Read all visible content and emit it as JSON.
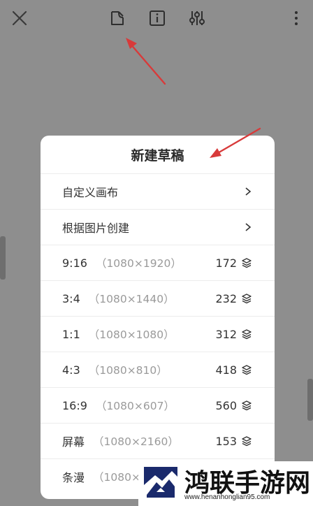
{
  "toolbar": {
    "icons": [
      "close-icon",
      "sticker-icon",
      "info-icon",
      "sliders-icon",
      "more-vertical-icon"
    ]
  },
  "dialog": {
    "title": "新建草稿",
    "options": [
      {
        "label": "自定义画布"
      },
      {
        "label": "根据图片创建"
      }
    ],
    "presets": [
      {
        "ratio": "9:16",
        "resolution": "（1080×1920）",
        "layers": "172"
      },
      {
        "ratio": "3:4",
        "resolution": "（1080×1440）",
        "layers": "232"
      },
      {
        "ratio": "1:1",
        "resolution": "（1080×1080）",
        "layers": "312"
      },
      {
        "ratio": "4:3",
        "resolution": "（1080×810）",
        "layers": "418"
      },
      {
        "ratio": "16:9",
        "resolution": "（1080×607）",
        "layers": "560"
      },
      {
        "ratio": "屏幕",
        "resolution": "（1080×2160）",
        "layers": "153"
      },
      {
        "ratio": "条漫",
        "resolution": "（1080×4"
      }
    ]
  },
  "watermark": {
    "name": "鸿联手游网",
    "url": "www.henanhonglian95.com"
  },
  "colors": {
    "backdrop": "#8e8e8e",
    "sheet": "#ffffff",
    "arrow": "#d83a3a"
  }
}
